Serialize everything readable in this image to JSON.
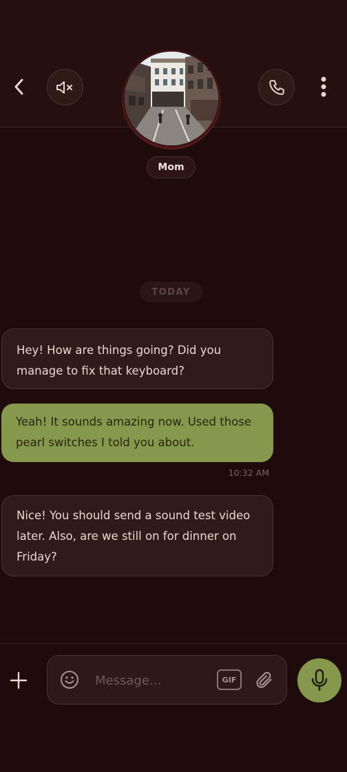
{
  "header": {
    "contact_name": "Mom",
    "back_icon": "chevron-left-icon",
    "mute_icon": "speaker-muted-icon",
    "call_icon": "phone-icon",
    "more_icon": "more-vertical-icon"
  },
  "chat": {
    "day_label": "TODAY",
    "messages": [
      {
        "direction": "incoming",
        "text": "Hey! How are things going? Did you manage to fix that keyboard?"
      },
      {
        "direction": "outgoing",
        "text": "Yeah! It sounds amazing now. Used those pearl switches I told you about.",
        "time": "10:32 AM"
      },
      {
        "direction": "incoming",
        "text": "Nice! You should send a sound test video later. Also, are we still on for dinner on Friday?"
      }
    ]
  },
  "composer": {
    "placeholder": "Message...",
    "value": "",
    "gif_label": "GIF",
    "plus_icon": "plus-icon",
    "emoji_icon": "smiley-icon",
    "attach_icon": "paperclip-icon",
    "mic_icon": "microphone-icon"
  },
  "colors": {
    "background": "#1e0c0c",
    "header": "#250f0f",
    "incoming_bubble": "#2f1c1a",
    "outgoing_bubble": "#86984c",
    "accent": "#86984c"
  }
}
